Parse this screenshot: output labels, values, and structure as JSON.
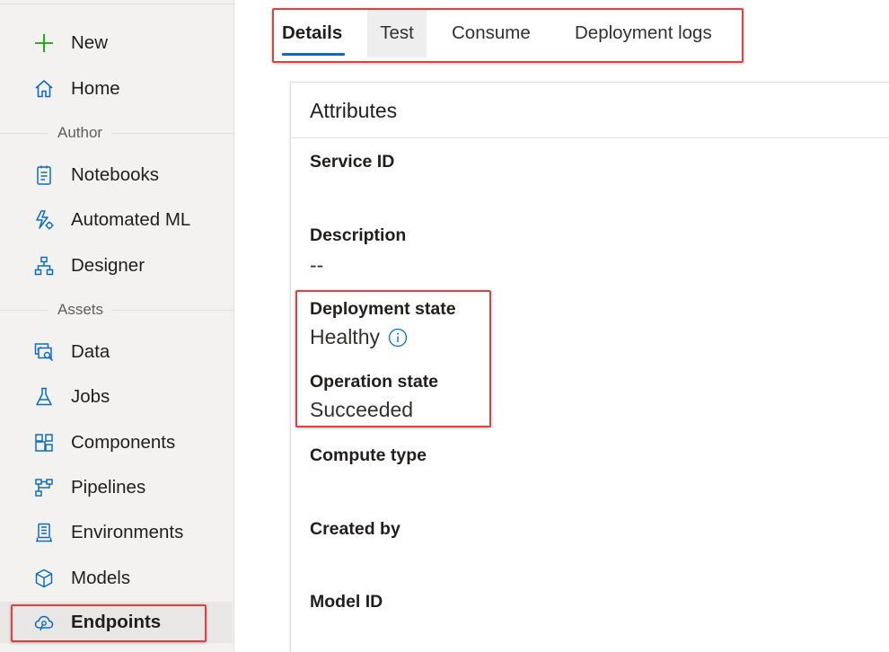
{
  "sidebar": {
    "top_items": [
      {
        "label": "New",
        "icon": "plus-icon"
      },
      {
        "label": "Home",
        "icon": "home-icon"
      }
    ],
    "sections": [
      {
        "title": "Author",
        "items": [
          {
            "label": "Notebooks",
            "icon": "notebook-icon"
          },
          {
            "label": "Automated ML",
            "icon": "automated-ml-icon"
          },
          {
            "label": "Designer",
            "icon": "designer-icon"
          }
        ]
      },
      {
        "title": "Assets",
        "items": [
          {
            "label": "Data",
            "icon": "data-icon"
          },
          {
            "label": "Jobs",
            "icon": "flask-icon"
          },
          {
            "label": "Components",
            "icon": "components-icon"
          },
          {
            "label": "Pipelines",
            "icon": "pipelines-icon"
          },
          {
            "label": "Environments",
            "icon": "environments-icon"
          },
          {
            "label": "Models",
            "icon": "cube-icon"
          },
          {
            "label": "Endpoints",
            "icon": "cloud-endpoint-icon",
            "active": true
          }
        ]
      }
    ]
  },
  "tabs": [
    {
      "label": "Details",
      "active": true
    },
    {
      "label": "Test",
      "hovered": true
    },
    {
      "label": "Consume"
    },
    {
      "label": "Deployment logs"
    }
  ],
  "attributes": {
    "title": "Attributes",
    "fields": [
      {
        "label": "Service ID",
        "value": ""
      },
      {
        "label": "Description",
        "value": "--"
      },
      {
        "label": "Deployment state",
        "value": "Healthy",
        "icon": "info-icon"
      },
      {
        "label": "Operation state",
        "value": "Succeeded"
      },
      {
        "label": "Compute type",
        "value": ""
      },
      {
        "label": "Created by",
        "value": ""
      },
      {
        "label": "Model ID",
        "value": ""
      }
    ]
  },
  "colors": {
    "accent": "#0f6cbd",
    "plus_green": "#13a10e",
    "highlight_red": "#e0403f",
    "sidebar_bg": "#f3f2f1"
  }
}
